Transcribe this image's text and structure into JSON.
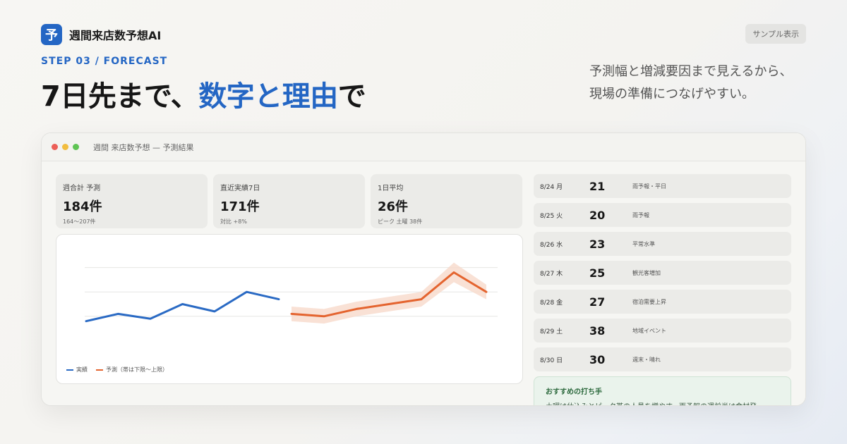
{
  "brand": {
    "logo_char": "予",
    "name": "週間来店数予想AI"
  },
  "badge": "サンプル表示",
  "step": "STEP 03 / FORECAST",
  "headline": {
    "part1": "7日先まで、",
    "highlight": "数字と理由",
    "part2": "で"
  },
  "lead": {
    "line1": "予測幅と増減要因まで見えるから、",
    "line2": "現場の準備につなげやすい。"
  },
  "window": {
    "title": "週間 来店数予想 — 予測結果"
  },
  "kpis": [
    {
      "label": "週合計 予測",
      "value": "184件",
      "sub": "164〜207件"
    },
    {
      "label": "直近実績7日",
      "value": "171件",
      "sub": "対比 +8%"
    },
    {
      "label": "1日平均",
      "value": "26件",
      "sub": "ピーク 土曜 38件"
    }
  ],
  "days": [
    {
      "date": "8/24 月",
      "value": "21",
      "note": "雨予報・平日"
    },
    {
      "date": "8/25 火",
      "value": "20",
      "note": "雨予報"
    },
    {
      "date": "8/26 水",
      "value": "23",
      "note": "平常水準"
    },
    {
      "date": "8/27 木",
      "value": "25",
      "note": "観光客増加"
    },
    {
      "date": "8/28 金",
      "value": "27",
      "note": "宿泊需要上昇"
    },
    {
      "date": "8/29 土",
      "value": "38",
      "note": "地域イベント"
    },
    {
      "date": "8/30 日",
      "value": "30",
      "note": "週末・晴れ"
    }
  ],
  "recommendation": {
    "title": "おすすめの打ち手",
    "body": "土曜は仕込みとピーク帯の人員を増やす。雨予報の週前半は食材発"
  },
  "colors": {
    "accent": "#2466c4",
    "actual": "#2a6ac4",
    "forecast": "#e4642f",
    "band": "#f8d9cb"
  },
  "chart_data": {
    "type": "line",
    "series": [
      {
        "name": "実績",
        "values": [
          18,
          21,
          19,
          25,
          22,
          30,
          27
        ]
      },
      {
        "name": "予測",
        "values": [
          21,
          20,
          23,
          25,
          27,
          38,
          30
        ],
        "lower": [
          18,
          17,
          20,
          22,
          24,
          34,
          27
        ],
        "upper": [
          24,
          23,
          26,
          28,
          30,
          42,
          33
        ]
      }
    ],
    "legend": {
      "actual": "実績",
      "forecast": "予測（帯は下限〜上限）"
    },
    "ylim": [
      0,
      50
    ],
    "grid": true,
    "legend_position": "bottom-left"
  }
}
